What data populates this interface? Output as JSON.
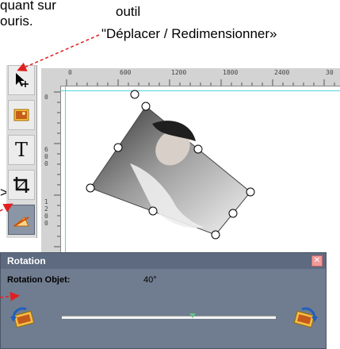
{
  "annotations": {
    "top_left_line1": "quant sur",
    "top_left_line2": "ouris.",
    "outil": "outil",
    "deplacer": "\"Déplacer / Redimensionner»",
    "left_fragment": ">."
  },
  "ruler": {
    "ticks": [
      "0",
      "600",
      "1200",
      "1800",
      "2400",
      "30"
    ],
    "v_ticks": [
      "0",
      "6 0 0",
      "1 2 0 0"
    ]
  },
  "toolbar": {
    "tools": [
      "move-resize-tool",
      "image-tool",
      "text-tool",
      "crop-tool",
      "rotate-tool"
    ],
    "text_tool_glyph": "T",
    "active_tool": "rotate-tool"
  },
  "rotation_panel": {
    "title": "Rotation",
    "close_glyph": "✕",
    "label": "Rotation Objet:",
    "value": "40°",
    "angle_level": 0.61
  },
  "colors": {
    "panel_bg": "#707c8f",
    "guide": "#53d6de",
    "arrow": "#e02020",
    "active_tool_bg": "#8a95a6"
  }
}
